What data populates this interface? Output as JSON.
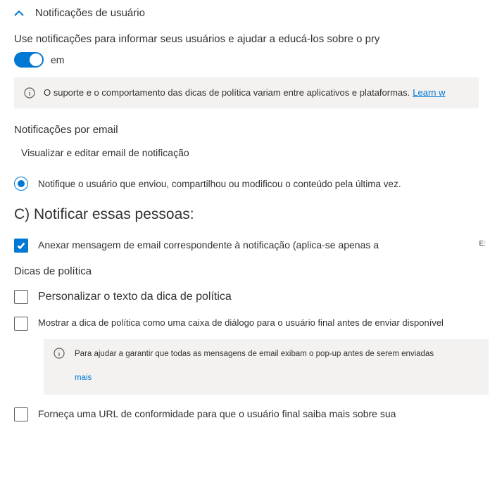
{
  "header": {
    "title": "Notificações de usuário"
  },
  "description": "Use notificações para informar seus usuários e ajudar a educá-los sobre o pry",
  "toggle": {
    "state": "em"
  },
  "banner1": {
    "text": "O suporte e o comportamento das dicas de política variam entre aplicativos e plataformas.",
    "link": "Learn w"
  },
  "email": {
    "heading": "Notificações por email",
    "editLink": "Visualizar e editar email de notificação",
    "radioLabel": "Notifique o usuário que enviou, compartilhou ou modificou o conteúdo pela última vez."
  },
  "notify": {
    "heading": "C) Notificar essas pessoas:",
    "attachLabel": "Anexar mensagem de email correspondente à notificação (aplica-se apenas a",
    "sideLetter": "E:"
  },
  "tips": {
    "heading": "Dicas de política",
    "customize": "Personalizar o texto da dica de política",
    "dialog": "Mostrar a dica de política como uma caixa de diálogo para o usuário final antes de enviar disponível",
    "banner": {
      "text": "Para ajudar a garantir que todas as mensagens de email exibam o pop-up antes de serem enviadas",
      "more": "mais"
    },
    "url": "Forneça uma URL de conformidade para que o usuário final saiba mais sobre sua"
  }
}
